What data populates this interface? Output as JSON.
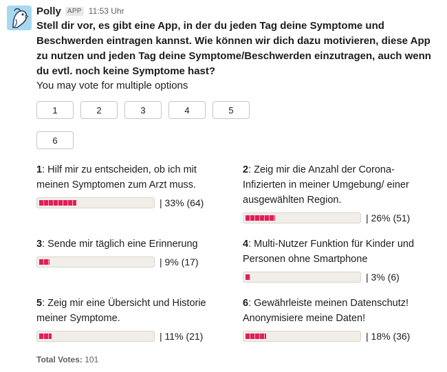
{
  "message": {
    "sender": "Polly",
    "badge": "APP",
    "time": "11:53 Uhr",
    "question": "Stell dir vor, es gibt eine App, in der du jeden Tag deine Symptome und Beschwerden eintragen kannst. Wie können wir dich dazu motivieren, diese App zu nutzen und jeden Tag deine Symptome/Beschwerden einzutragen, auch wenn du evtl. noch keine Symptome hast?",
    "subtext": "You may vote for multiple options"
  },
  "vote_buttons": [
    "1",
    "2",
    "3",
    "4",
    "5",
    "6"
  ],
  "options": [
    {
      "num": "1",
      "text": "Hilf mir zu entscheiden, ob ich mit meinen Symptomen zum Arzt muss.",
      "percent": 33,
      "result": "33% (64)"
    },
    {
      "num": "2",
      "text": "Zeig mir die Anzahl der Corona-Infizierten in meiner Umgebung/ einer ausgewählten Region.",
      "percent": 26,
      "result": "26% (51)"
    },
    {
      "num": "3",
      "text": "Sende mir täglich eine Erinnerung",
      "percent": 9,
      "result": "9% (17)"
    },
    {
      "num": "4",
      "text": "Multi-Nutzer Funktion für Kinder und Personen ohne Smartphone",
      "percent": 3,
      "result": "3% (6)"
    },
    {
      "num": "5",
      "text": "Zeig mir eine Übersicht und Historie meiner Symptome.",
      "percent": 11,
      "result": "11% (21)"
    },
    {
      "num": "6",
      "text": "Gewährleiste meinen Datenschutz! Anonymisiere meine Daten!",
      "percent": 18,
      "result": "18% (36)"
    }
  ],
  "total": {
    "label": "Total Votes:",
    "value": "101"
  },
  "colors": {
    "bar_fill": "#e01e5a",
    "bar_bg": "#f1eee8"
  }
}
